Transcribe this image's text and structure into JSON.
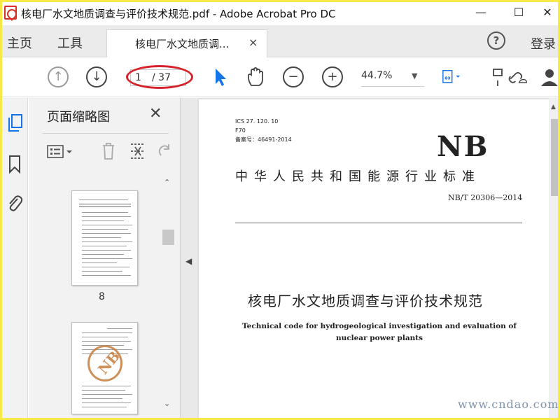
{
  "window": {
    "title": "核电厂水文地质调查与评价技术规范.pdf - Adobe Acrobat Pro DC",
    "minimize": "—",
    "maximize": "☐",
    "close": "✕"
  },
  "menubar": {
    "home": "主页",
    "tools": "工具",
    "doc_tab": "核电厂水文地质调...",
    "doc_tab_close": "×",
    "help": "?",
    "login": "登录"
  },
  "toolbar": {
    "page_current": "1",
    "page_total": "/ 37",
    "zoom": "44.7%",
    "highlight_color": "#d6232b"
  },
  "thumbnail_panel": {
    "title": "页面缩略图",
    "close": "✕",
    "thumbnails": [
      {
        "label": "8"
      }
    ]
  },
  "document": {
    "ics": "ICS  27. 120. 10",
    "class_code": "F70",
    "record_no": "备案号：46491-2014",
    "logo": "NB",
    "standard_title": "中华人民共和国能源行业标准",
    "standard_code": "NB/T 20306—2014",
    "title_cn": "核电厂水文地质调查与评价技术规范",
    "title_en": "Technical code for hydrogeological investigation and evaluation of nuclear power plants"
  },
  "watermark": "www.cndao.com",
  "colors": {
    "frame": "#f7e948",
    "tab_bar": "#ebebeb",
    "panel": "#f2f2f2",
    "accent_blue": "#1473e6"
  }
}
